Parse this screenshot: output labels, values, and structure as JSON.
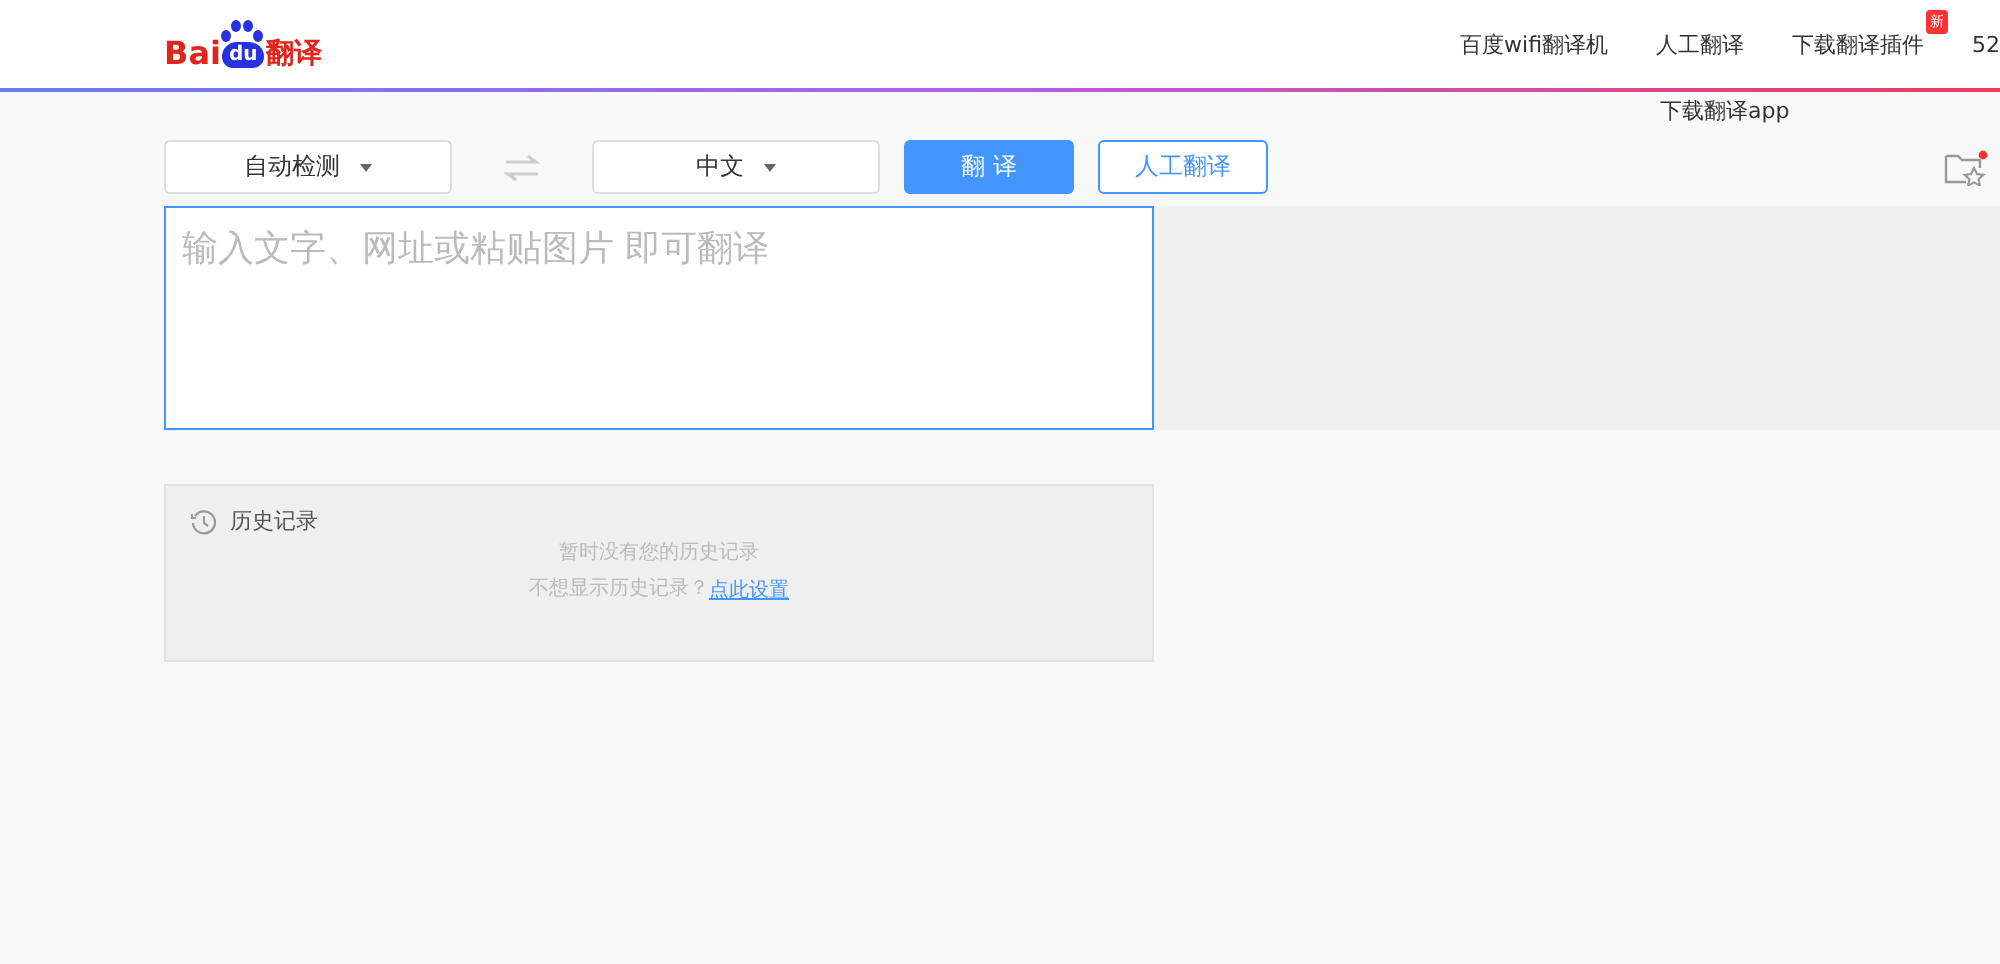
{
  "header": {
    "logo": {
      "brand": "Bai",
      "paw_text": "du",
      "product": "翻译"
    },
    "nav": [
      {
        "label": "百度wifi翻译机"
      },
      {
        "label": "人工翻译"
      },
      {
        "label": "下载翻译插件",
        "badge": "新"
      },
      {
        "label": "52"
      }
    ],
    "dropdown": {
      "label": "下载翻译app"
    }
  },
  "toolbar": {
    "source_language": "自动检测",
    "target_language": "中文",
    "translate_button": "翻 译",
    "human_button": "人工翻译"
  },
  "input": {
    "placeholder": "输入文字、网址或粘贴图片 即可翻译"
  },
  "history": {
    "title": "历史记录",
    "empty_text": "暂时没有您的历史记录",
    "hint": "不想显示历史记录？",
    "link": "点此设置"
  }
}
